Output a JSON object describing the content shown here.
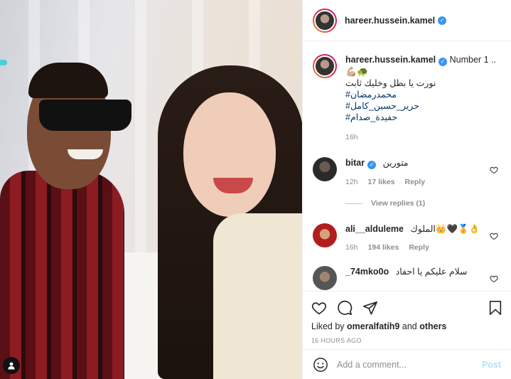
{
  "header": {
    "username": "hareer.hussein.kamel",
    "verified_icon": "verified-badge-icon"
  },
  "caption": {
    "username": "hareer.hussein.kamel",
    "text_first": "Number 1 ..",
    "emojis": "💪🏼🐢",
    "line_arabic": "نورت يا بطل وخليك ثابت",
    "hashtags": [
      "#محمدرمضان",
      "#حرير_حسين_كامل",
      "#حفيدة_صدام"
    ],
    "time": "16h"
  },
  "comments": [
    {
      "username": "bitar",
      "verified": true,
      "text": "متورين",
      "time": "12h",
      "likes": "17 likes",
      "reply": "Reply",
      "view_replies": "View replies (1)"
    },
    {
      "username": "ali__alduleme",
      "verified": false,
      "text": "الملوك👑🖤🏅👌",
      "time": "16h",
      "likes": "194 likes",
      "reply": "Reply"
    },
    {
      "username": "_74mko0o",
      "verified": false,
      "text": "سلام عليكم يا احفاد"
    }
  ],
  "liked_by": {
    "prefix": "Liked by",
    "user": "omeralfatih9",
    "joiner": "and",
    "others": "others"
  },
  "timestamp": "16 HOURS AGO",
  "add_comment": {
    "placeholder": "Add a comment...",
    "post_label": "Post"
  },
  "colors": {
    "link_blue": "#00376b",
    "verified_blue": "#3897f0",
    "muted": "#8e8e8e",
    "post_disabled": "#b2dffc"
  }
}
